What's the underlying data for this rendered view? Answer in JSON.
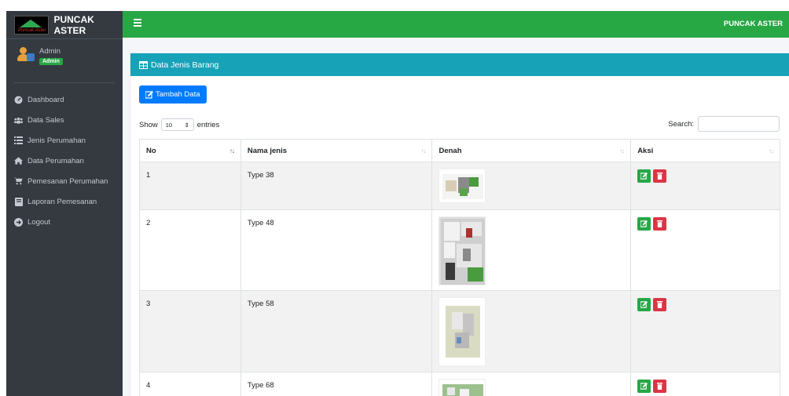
{
  "brand": {
    "name": "PUNCAK ASTER",
    "logo_script": "Puncak Aster"
  },
  "user": {
    "name": "Admin",
    "badge": "Admin"
  },
  "sidebar": {
    "items": [
      {
        "label": "Dashboard",
        "icon": "tachometer-icon"
      },
      {
        "label": "Data Sales",
        "icon": "users-icon"
      },
      {
        "label": "Jenis Perumahan",
        "icon": "list-icon"
      },
      {
        "label": "Data Perumahan",
        "icon": "home-icon"
      },
      {
        "label": "Pemesanan Perumahan",
        "icon": "cart-icon"
      },
      {
        "label": "Laporan Pemesanan",
        "icon": "book-icon"
      },
      {
        "label": "Logout",
        "icon": "logout-icon"
      }
    ]
  },
  "header": {
    "brand": "PUNCAK ASTER"
  },
  "card": {
    "title": "Data Jenis Barang"
  },
  "toolbar": {
    "add_label": "Tambah Data",
    "show_label": "Show",
    "entries_label": "entries",
    "entries_value": "10",
    "search_label": "Search:"
  },
  "table": {
    "columns": [
      "No",
      "Nama jenis",
      "Denah",
      "Aksi"
    ],
    "rows": [
      {
        "no": "1",
        "nama": "Type 38"
      },
      {
        "no": "2",
        "nama": "Type 48"
      },
      {
        "no": "3",
        "nama": "Type 58"
      },
      {
        "no": "4",
        "nama": "Type 68"
      }
    ]
  },
  "colors": {
    "header": "#28a745",
    "card_header": "#17a2b8",
    "sidebar": "#343a40",
    "primary": "#007bff",
    "danger": "#dc3545"
  }
}
